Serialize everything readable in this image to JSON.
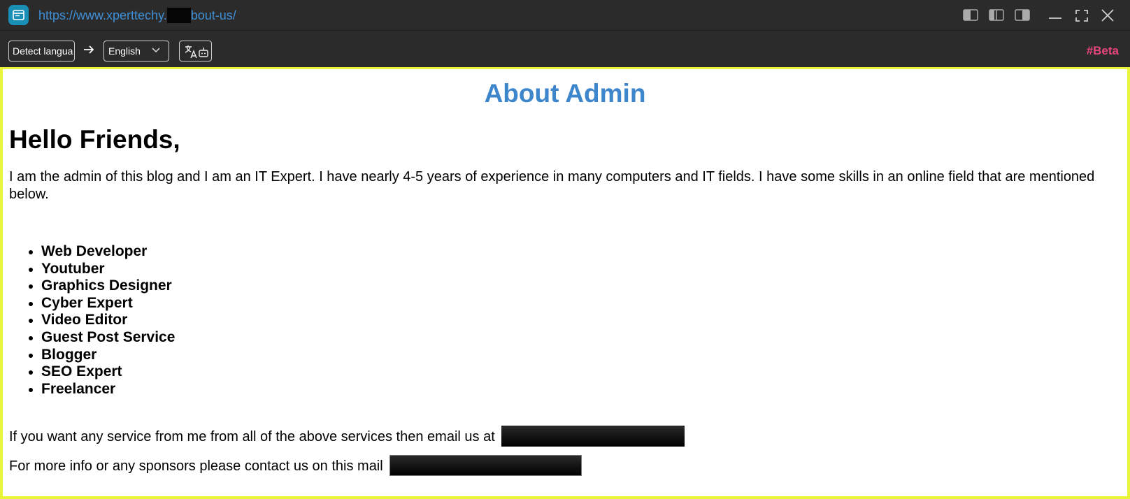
{
  "window": {
    "url_prefix": "https://www.xperttechy.",
    "url_suffix": "bout-us/"
  },
  "toolbar": {
    "source_language": "Detect langua",
    "target_language": "English",
    "beta_label": "#Beta"
  },
  "page": {
    "title": "About Admin",
    "greeting": "Hello Friends,",
    "intro": "I am the admin of this blog and I am an IT Expert. I have nearly 4-5 years of experience in many computers and IT fields. I have some skills in an online field that are mentioned below.",
    "skills": [
      "Web Developer",
      "Youtuber",
      "Graphics Designer",
      "Cyber Expert",
      "Video Editor",
      "Guest Post Service",
      "Blogger",
      "SEO Expert",
      "Freelancer"
    ],
    "service_line": "If you want any service from me from all of the above services then email us at",
    "contact_line": "For more info or any sponsors please contact us on this mail"
  },
  "colors": {
    "accent": "#3d86cc",
    "beta": "#e8457a",
    "highlight_border": "#e9f53a"
  },
  "icons": {
    "app": "browser-window-icon",
    "arrow": "arrow-right-icon",
    "translate": "translate-icon"
  }
}
